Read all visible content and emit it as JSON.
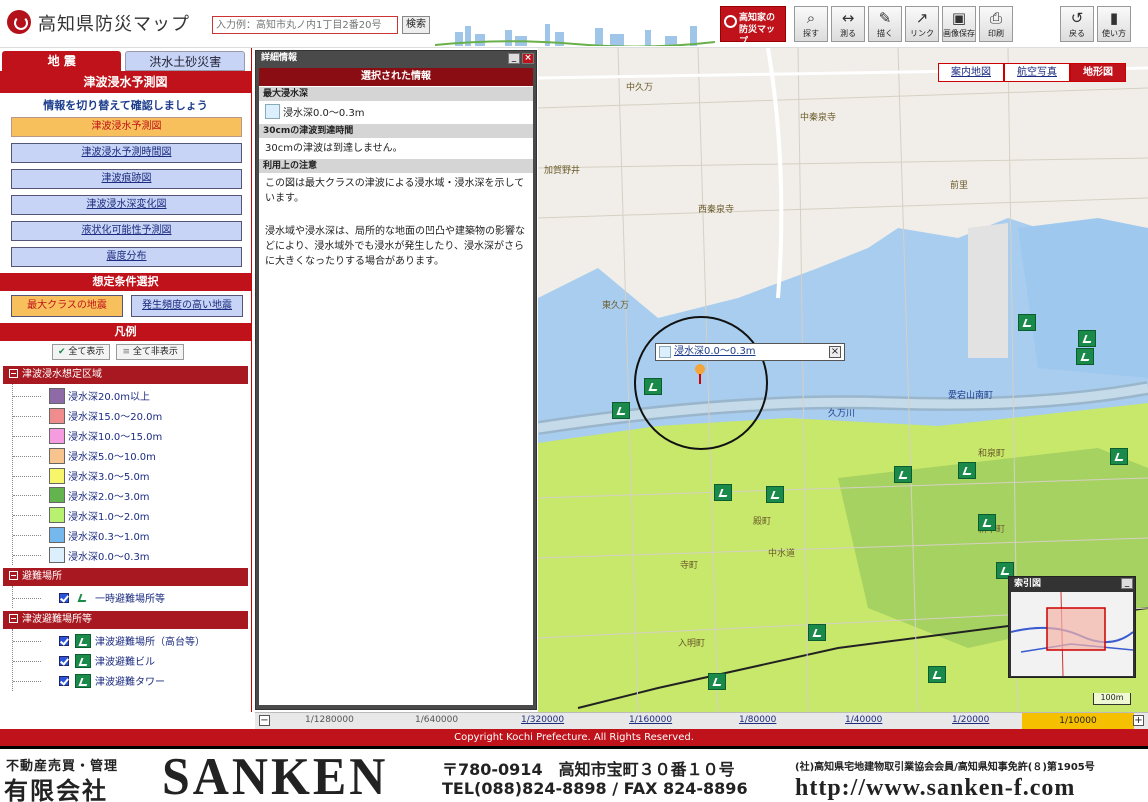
{
  "header": {
    "title": "高知県防災マップ",
    "search_placeholder": "入力例：高知市丸ノ内1丁目2番20号",
    "search_label": "検索",
    "bousai_label_1": "高知家の",
    "bousai_label_2": "防災マップ",
    "tools": [
      {
        "label": "探す",
        "icon": "magnifier-icon"
      },
      {
        "label": "測る",
        "icon": "ruler-icon"
      },
      {
        "label": "描く",
        "icon": "draw-icon"
      },
      {
        "label": "リンク",
        "icon": "link-icon"
      },
      {
        "label": "画像保存",
        "icon": "save-image-icon"
      },
      {
        "label": "印刷",
        "icon": "print-icon"
      },
      {
        "label": "戻る",
        "icon": "back-icon"
      },
      {
        "label": "使い方",
        "icon": "help-icon"
      }
    ]
  },
  "left": {
    "tabs": [
      "地 震",
      "洪水土砂災害"
    ],
    "section_title": "津波浸水予測図",
    "info": "情報を切り替えて確認しましょう",
    "menu": [
      {
        "label": "津波浸水予測図",
        "selected": true
      },
      {
        "label": "津波浸水予測時間図",
        "selected": false
      },
      {
        "label": "津波痕跡図",
        "selected": false
      },
      {
        "label": "津波浸水深変化図",
        "selected": false
      },
      {
        "label": "液状化可能性予測図",
        "selected": false
      },
      {
        "label": "震度分布",
        "selected": false
      }
    ],
    "condition_title": "想定条件選択",
    "conditions": [
      "最大クラスの地震",
      "発生頻度の高い地震"
    ],
    "legend_title": "凡例",
    "show_all": "全て表示",
    "hide_all": "全て非表示",
    "groups": {
      "tsunami": "津波浸水想定区域",
      "shelter": "避難場所",
      "tsunami_shelter": "津波避難場所等"
    },
    "depth_items": [
      {
        "label": "浸水深20.0m以上",
        "color": "#8e6ba6"
      },
      {
        "label": "浸水深15.0～20.0m",
        "color": "#f08c8c"
      },
      {
        "label": "浸水深10.0～15.0m",
        "color": "#f59be0"
      },
      {
        "label": "浸水深5.0～10.0m",
        "color": "#f7c48e"
      },
      {
        "label": "浸水深3.0～5.0m",
        "color": "#f7f56a"
      },
      {
        "label": "浸水深2.0～3.0m",
        "color": "#63b44e"
      },
      {
        "label": "浸水深1.0～2.0m",
        "color": "#b8f070"
      },
      {
        "label": "浸水深0.3～1.0m",
        "color": "#74b8ee"
      },
      {
        "label": "浸水深0.0～0.3m",
        "color": "#dceffc"
      }
    ],
    "shelter_items": [
      "一時避難場所等"
    ],
    "tsunami_shelter_items": [
      "津波避難場所（高台等）",
      "津波避難ビル",
      "津波避難タワー"
    ]
  },
  "detail": {
    "title": "詳細情報",
    "selected_title": "選択された情報",
    "max_depth_heading": "最大浸水深",
    "max_depth_value": "浸水深0.0～0.3m",
    "arrival_heading": "30cmの津波到達時間",
    "arrival_value": "30cmの津波は到達しません。",
    "usage_heading": "利用上の注意",
    "usage_text_1": "この図は最大クラスの津波による浸水域・浸水深を示しています。",
    "usage_text_2": "浸水域や浸水深は、局所的な地面の凹凸や建築物の影響などにより、浸水域外でも浸水が発生したり、浸水深がさらに大きくなったりする場合があります。"
  },
  "map": {
    "tabs": [
      "案内地図",
      "航空写真",
      "地形図"
    ],
    "active_tab": 2,
    "popup_text": "浸水深0.0～0.3m",
    "index_title": "索引図",
    "scale_label": "100m",
    "places": [
      {
        "name": "中秦泉寺",
        "blue": false
      },
      {
        "name": "加賀野井",
        "blue": false
      },
      {
        "name": "西秦泉寺",
        "blue": false
      },
      {
        "name": "東久万",
        "blue": false
      },
      {
        "name": "愛宕山南町",
        "blue": true
      },
      {
        "name": "久万川",
        "blue": true
      },
      {
        "name": "和泉町",
        "blue": false
      },
      {
        "name": "殿町",
        "blue": false
      },
      {
        "name": "中水道",
        "blue": false
      },
      {
        "name": "入明町",
        "blue": false
      },
      {
        "name": "中久万",
        "blue": false
      },
      {
        "name": "前里",
        "blue": false
      },
      {
        "name": "新本町",
        "blue": false
      },
      {
        "name": "寺町",
        "blue": false
      }
    ],
    "zoom_levels": [
      "1/1280000",
      "1/640000",
      "1/320000",
      "1/160000",
      "1/80000",
      "1/40000",
      "1/20000",
      "1/10000"
    ],
    "current_zoom": "1/10000"
  },
  "copyright": "Copyright Kochi Prefecture. All Rights Reserved.",
  "banner": {
    "line1": "不動産売買・管理",
    "line2": "有限会社",
    "company": "SANKEN",
    "address": "〒780-0914　高知市宝町３０番１０号",
    "tel": "TEL(088)824-8898 / FAX 824-8896",
    "assoc": "(社)高知県宅地建物取引業協会会員/高知県知事免許(８)第1905号",
    "url": "http://www.sanken-f.com"
  }
}
